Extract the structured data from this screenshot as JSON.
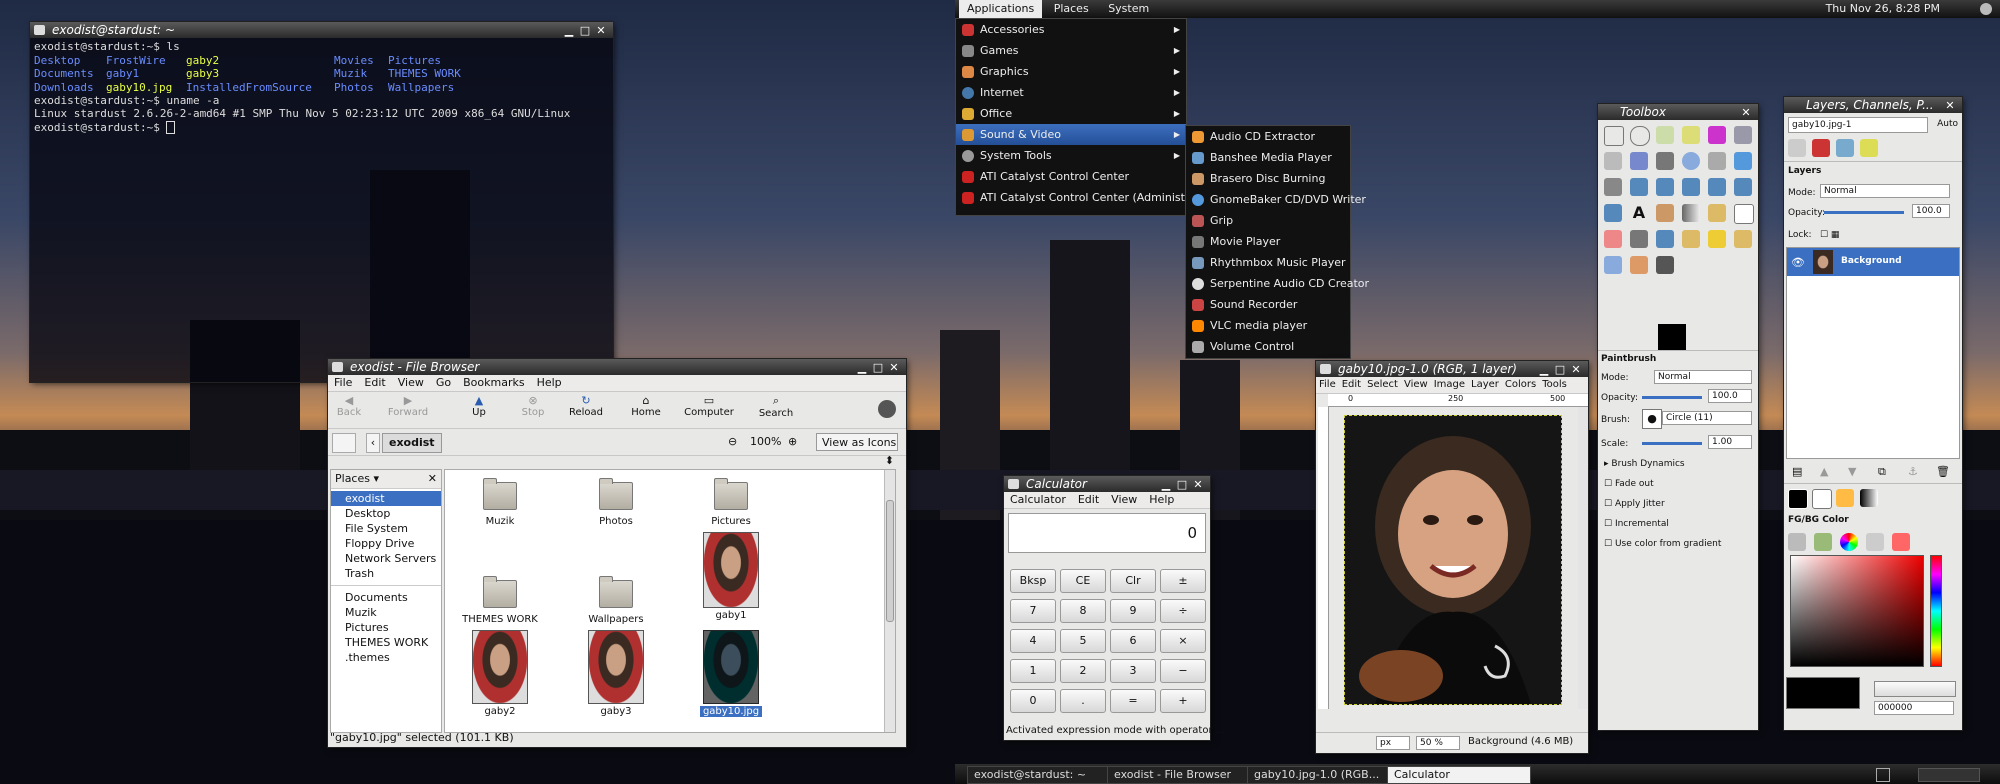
{
  "terminal": {
    "title": "exodist@stardust: ~",
    "lines": [
      "exodist@stardust:~$ ls",
      "exodist@stardust:~$ uname -a",
      "Linux stardust 2.6.26-2-amd64 #1 SMP Thu Nov 5 02:23:12 UTC 2009 x86_64 GNU/Linux",
      "exodist@stardust:~$"
    ],
    "ls_columns": [
      [
        "Desktop",
        "Documents",
        "Downloads"
      ],
      [
        "FrostWire",
        "gaby1",
        "gaby10.jpg"
      ],
      [
        "gaby2",
        "gaby3",
        "InstalledFromSource"
      ],
      [
        "Movies",
        "Muzik",
        "Photos"
      ],
      [
        "Pictures",
        "THEMES WORK",
        "Wallpapers"
      ]
    ]
  },
  "top_panel": {
    "menus": [
      "Applications",
      "Places",
      "System"
    ],
    "clock": "Thu Nov 26,  8:28 PM"
  },
  "apps_menu": {
    "items": [
      "Accessories",
      "Games",
      "Graphics",
      "Internet",
      "Office",
      "Sound & Video",
      "System Tools",
      "ATI Catalyst Control Center",
      "ATI Catalyst Control Center (Administrative)"
    ],
    "submenu": [
      "Audio CD Extractor",
      "Banshee Media Player",
      "Brasero Disc Burning",
      "GnomeBaker CD/DVD Writer",
      "Grip",
      "Movie Player",
      "Rhythmbox Music Player",
      "Serpentine Audio CD Creator",
      "Sound Recorder",
      "VLC media player",
      "Volume Control"
    ]
  },
  "file_browser": {
    "title": "exodist - File Browser",
    "menus": [
      "File",
      "Edit",
      "View",
      "Go",
      "Bookmarks",
      "Help"
    ],
    "toolbar": [
      "Back",
      "Forward",
      "Up",
      "Stop",
      "Reload",
      "Home",
      "Computer",
      "Search"
    ],
    "location": "exodist",
    "zoom": "100%",
    "view_mode": "View as Icons",
    "places_label": "Places",
    "places": [
      "exodist",
      "Desktop",
      "File System",
      "Floppy Drive",
      "Network Servers",
      "Trash"
    ],
    "bookmarks": [
      "Documents",
      "Muzik",
      "Pictures",
      "THEMES WORK",
      ".themes"
    ],
    "files": [
      "Muzik",
      "Photos",
      "Pictures",
      "THEMES WORK",
      "Wallpapers",
      "gaby1",
      "gaby2",
      "gaby3",
      "gaby10.jpg"
    ],
    "status": "\"gaby10.jpg\" selected (101.1 KB)"
  },
  "calculator": {
    "title": "Calculator",
    "menus": [
      "Calculator",
      "Edit",
      "View",
      "Help"
    ],
    "display": "0",
    "buttons": [
      "Bksp",
      "CE",
      "Clr",
      "±",
      "7",
      "8",
      "9",
      "÷",
      "4",
      "5",
      "6",
      "×",
      "1",
      "2",
      "3",
      "−",
      "0",
      ".",
      "=",
      "+"
    ],
    "status": "Activated expression mode with operator ..."
  },
  "gimp_image": {
    "title": "gaby10.jpg-1.0 (RGB, 1 layer)",
    "menus": [
      "File",
      "Edit",
      "Select",
      "View",
      "Image",
      "Layer",
      "Colors",
      "Tools"
    ],
    "ruler": [
      "0",
      "250",
      "500"
    ],
    "unit": "px",
    "zoom": "50 %",
    "status": "Background (4.6 MB)"
  },
  "toolbox": {
    "title": "Toolbox",
    "tool_name": "Paintbrush",
    "mode_label": "Mode:",
    "mode": "Normal",
    "opacity_label": "Opacity:",
    "opacity": "100.0",
    "brush_label": "Brush:",
    "brush": "Circle (11)",
    "scale_label": "Scale:",
    "scale": "1.00",
    "options": [
      "Brush Dynamics",
      "Fade out",
      "Apply Jitter",
      "Incremental",
      "Use color from gradient"
    ]
  },
  "layers": {
    "title": "Layers, Channels, P...",
    "image_select": "gaby10.jpg-1",
    "auto": "Auto",
    "section": "Layers",
    "mode_label": "Mode:",
    "mode": "Normal",
    "opacity_label": "Opacity:",
    "opacity": "100.0",
    "lock_label": "Lock:",
    "layer_name": "Background",
    "fgbg_label": "FG/BG Color",
    "hex": "000000"
  },
  "taskbar": [
    "exodist@stardust: ~",
    "exodist - File Browser",
    "gaby10.jpg-1.0 (RGB...",
    "Calculator"
  ]
}
